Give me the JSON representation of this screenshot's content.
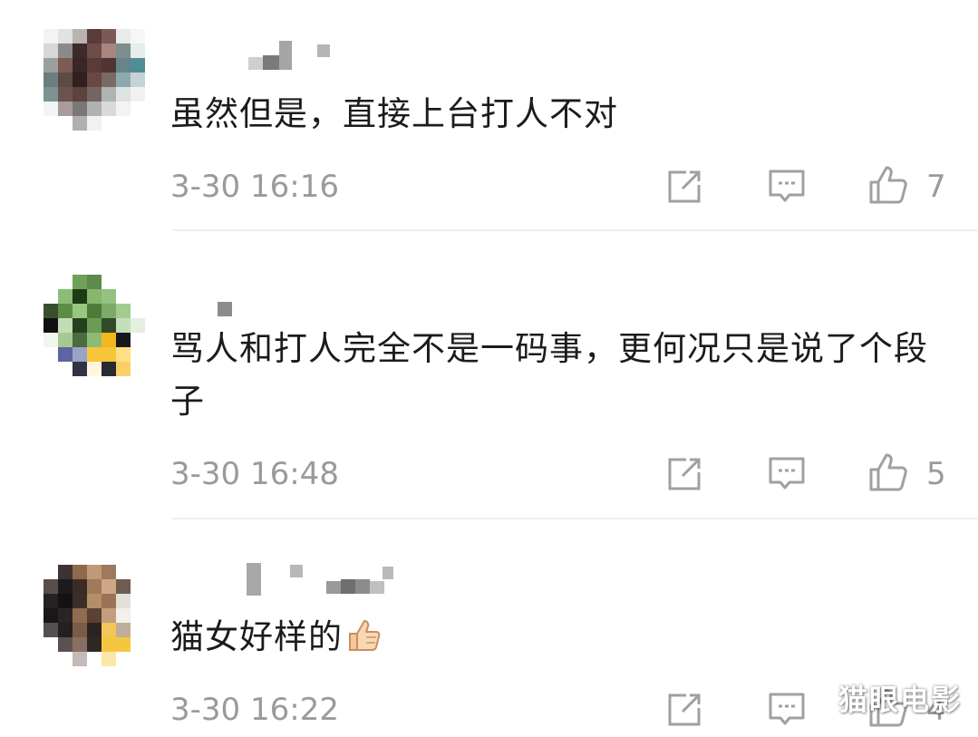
{
  "comments": [
    {
      "text": "虽然但是，直接上台打人不对",
      "time": "3-30 16:16",
      "likes": "7"
    },
    {
      "text": "骂人和打人完全不是一码事，更何况只是说了个段子",
      "time": "3-30 16:48",
      "likes": "5"
    },
    {
      "text": "猫女好样的",
      "emoji": "thumbs-up-icon",
      "time": "3-30 16:22",
      "likes": "4"
    }
  ],
  "watermark": "猫眼电影",
  "colors": {
    "text": "#1b1b1b",
    "meta": "#9a9a9a",
    "divider": "#eeeeee",
    "icon": "#a0a0a0"
  }
}
